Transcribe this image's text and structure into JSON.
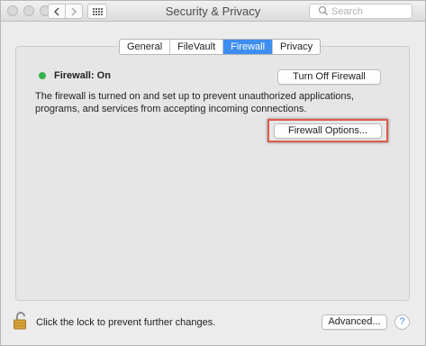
{
  "window": {
    "title": "Security & Privacy",
    "search_placeholder": "Search"
  },
  "tabs": [
    {
      "label": "General",
      "active": false
    },
    {
      "label": "FileVault",
      "active": false
    },
    {
      "label": "Firewall",
      "active": true
    },
    {
      "label": "Privacy",
      "active": false
    }
  ],
  "firewall": {
    "status_label": "Firewall: On",
    "status_color": "#34b34a",
    "toggle_button": "Turn Off Firewall",
    "description": "The firewall is turned on and set up to prevent unauthorized applications, programs, and services from accepting incoming connections.",
    "options_button": "Firewall Options...",
    "highlight_color": "#e05a4b"
  },
  "footer": {
    "lock_text": "Click the lock to prevent further changes.",
    "advanced_button": "Advanced...",
    "help_label": "?"
  },
  "icons": {
    "back": "chevron-left-icon",
    "forward": "chevron-right-icon",
    "grid": "grid-icon",
    "search": "search-icon",
    "lock": "lock-open-icon"
  },
  "colors": {
    "accent": "#3d8ef0"
  }
}
